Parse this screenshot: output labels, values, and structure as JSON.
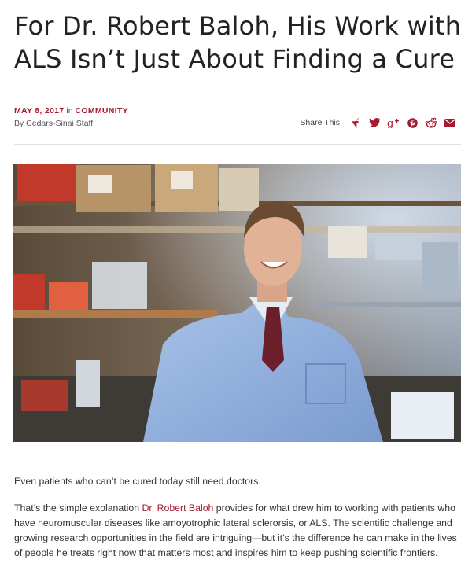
{
  "article": {
    "title": "For Dr. Robert Baloh, His Work with ALS Isn’t Just About Finding a Cure",
    "date": "MAY 8, 2017",
    "in_word": "in",
    "category": "COMMUNITY",
    "byline": "By Cedars-Sinai Staff"
  },
  "share": {
    "label": "Share This",
    "icons": [
      "facebook-icon",
      "twitter-icon",
      "google-plus-icon",
      "pinterest-icon",
      "reddit-icon",
      "email-icon"
    ],
    "icon_color": "#a6192e"
  },
  "body": {
    "p1": "Even patients who can’t be cured today still need doctors.",
    "p2_before": "That’s the simple explanation ",
    "p2_link": "Dr. Robert Baloh",
    "p2_after": " provides for what drew him to working with patients who have neuromuscular diseases like amoyotrophic lateral sclerorsis, or ALS. The scientific challenge and growing research opportunities in the field are intriguing—but it’s the difference he can make in the lives of people he treats right now that matters most and inspires him to keep pushing scientific frontiers."
  },
  "colors": {
    "accent": "#a6192e",
    "title_text": "#222222",
    "body_text": "#333333"
  }
}
